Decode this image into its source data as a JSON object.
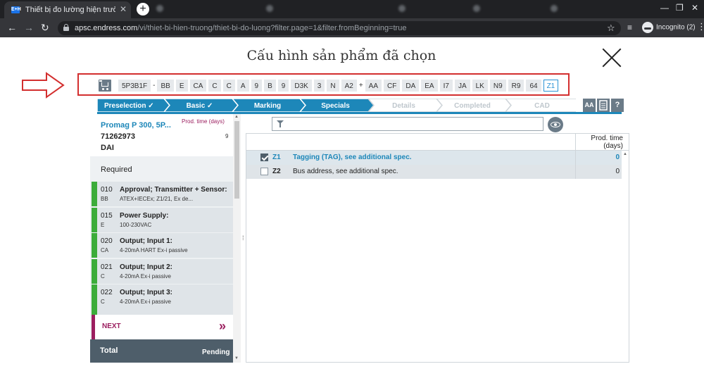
{
  "browser": {
    "tab_title": "Thiết bị đo lường hiện trường để",
    "tab_close": "✕",
    "new_tab": "+",
    "url_host": "apsc.endress.com",
    "url_path": "/vi/thiet-bi-hien-truong/thiet-bi-do-luong?filter.page=1&filter.fromBeginning=true",
    "profile": "Incognito (2)",
    "win_min": "—",
    "win_max": "❐",
    "win_close": "✕"
  },
  "page": {
    "title": "Cấu hình sản phẩm đã chọn"
  },
  "code_bar": {
    "main_code": "5P3B1F",
    "dash": "-",
    "plus": "+",
    "codes_a": [
      "BB",
      "E",
      "CA",
      "C",
      "C",
      "A",
      "9",
      "B",
      "9",
      "D3K",
      "3",
      "N",
      "A2"
    ],
    "codes_b": [
      "AA",
      "CF",
      "DA",
      "EA",
      "I7",
      "JA",
      "LK",
      "N9",
      "R9",
      "64"
    ],
    "selected_code": "Z1"
  },
  "steps": [
    {
      "label": "Preselection ✓",
      "state": "done"
    },
    {
      "label": "Basic ✓",
      "state": "done"
    },
    {
      "label": "Marking",
      "state": "done"
    },
    {
      "label": "Specials",
      "state": "active"
    },
    {
      "label": "Details",
      "state": "todo"
    },
    {
      "label": "Completed",
      "state": "todo"
    },
    {
      "label": "CAD",
      "state": "todo"
    }
  ],
  "tools": {
    "font_size": "AA",
    "help": "?"
  },
  "product": {
    "name": "Promag P 300, 5P...",
    "prod_time_label": "Prod. time (days)",
    "prod_time_value": "9",
    "order_code": "71262973",
    "short": "DAI"
  },
  "features": {
    "required_label": "Required",
    "items": [
      {
        "num": "010",
        "name": "Approval; Transmitter + Sensor:",
        "code": "BB",
        "value": "ATEX+IECEx; Z1/21, Ex de..."
      },
      {
        "num": "015",
        "name": "Power Supply:",
        "code": "E",
        "value": "100-230VAC"
      },
      {
        "num": "020",
        "name": "Output; Input 1:",
        "code": "CA",
        "value": "4-20mA HART Ex-i passive"
      },
      {
        "num": "021",
        "name": "Output; Input 2:",
        "code": "C",
        "value": "4-20mA Ex-i passive"
      },
      {
        "num": "022",
        "name": "Output; Input 3:",
        "code": "C",
        "value": "4-20mA Ex-i passive"
      }
    ],
    "next_label": "NEXT",
    "next_chevron": "»",
    "total_label": "Total",
    "total_value": "Pending"
  },
  "options_table": {
    "col_prod_time": "Prod. time (days)",
    "rows": [
      {
        "code": "Z1",
        "name": "Tagging (TAG), see additional spec.",
        "time": "0",
        "checked": true
      },
      {
        "code": "Z2",
        "name": "Bus address, see additional spec.",
        "time": "0",
        "checked": false
      }
    ]
  },
  "colors": {
    "accent_blue": "#1d87b9",
    "required_green": "#3cac3a",
    "next_magenta": "#9b1e5f",
    "highlight_red": "#d32f2f"
  }
}
